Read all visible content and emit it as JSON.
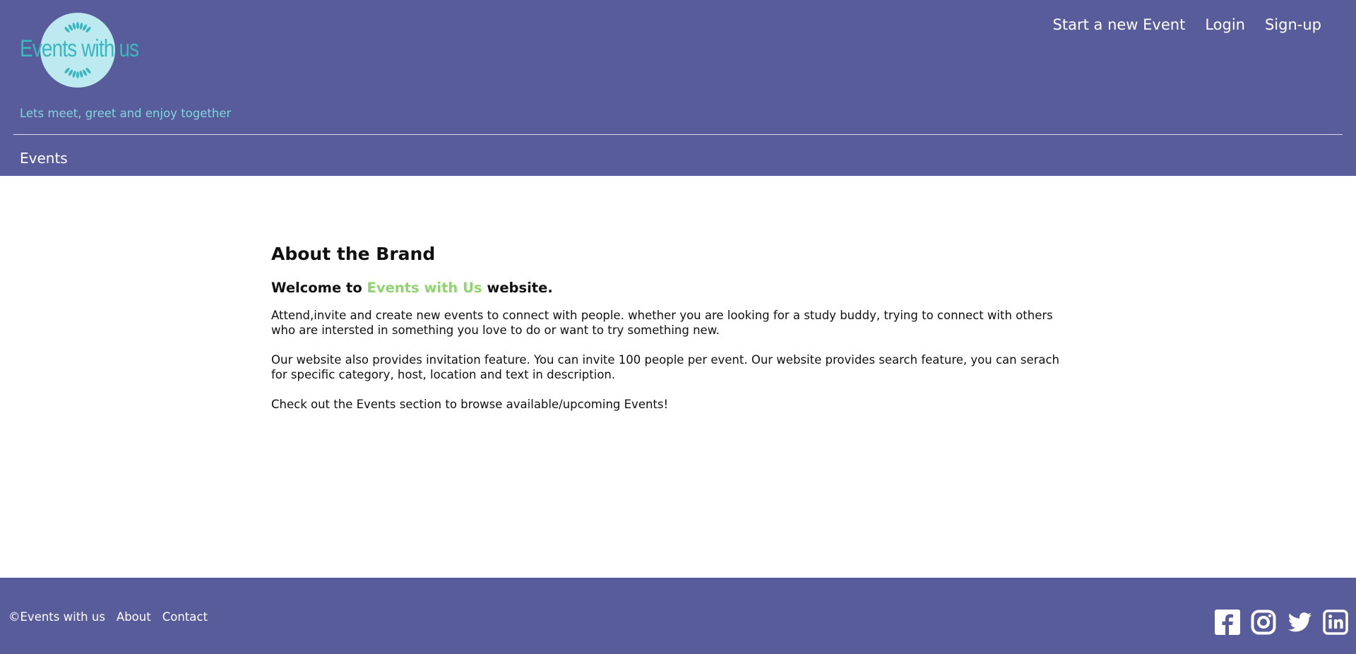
{
  "header": {
    "logo_text": "Events with us",
    "tagline": "Lets meet, greet and enjoy together",
    "nav": {
      "start_event": "Start a new Event",
      "login": "Login",
      "signup": "Sign-up"
    },
    "secondary_nav": {
      "events": "Events"
    }
  },
  "main": {
    "heading": "About the Brand",
    "welcome_prefix": "Welcome to ",
    "welcome_brand": "Events with Us",
    "welcome_suffix": " website.",
    "paragraphs": [
      "Attend,invite and create new events to connect with people. whether you are looking for a study buddy, trying to connect with others who are intersted in something you love to do or want to try something new.",
      "Our website also provides invitation feature. You can invite 100 people per event. Our website provides search feature, you can serach for specific category, host, location and text in description.",
      "Check out the Events section to browse available/upcoming Events!"
    ]
  },
  "footer": {
    "copyright": "©Events with us",
    "about": "About",
    "contact": "Contact",
    "social_icons": [
      "facebook-icon",
      "instagram-icon",
      "twitter-icon",
      "linkedin-icon"
    ]
  },
  "colors": {
    "header_bg": "#585c9a",
    "footer_bg": "#585c9a",
    "logo_circle": "#bdeaf0",
    "logo_text": "#3bb7bd",
    "tagline": "#7fd6df",
    "brand_highlight": "#8fd46e"
  }
}
